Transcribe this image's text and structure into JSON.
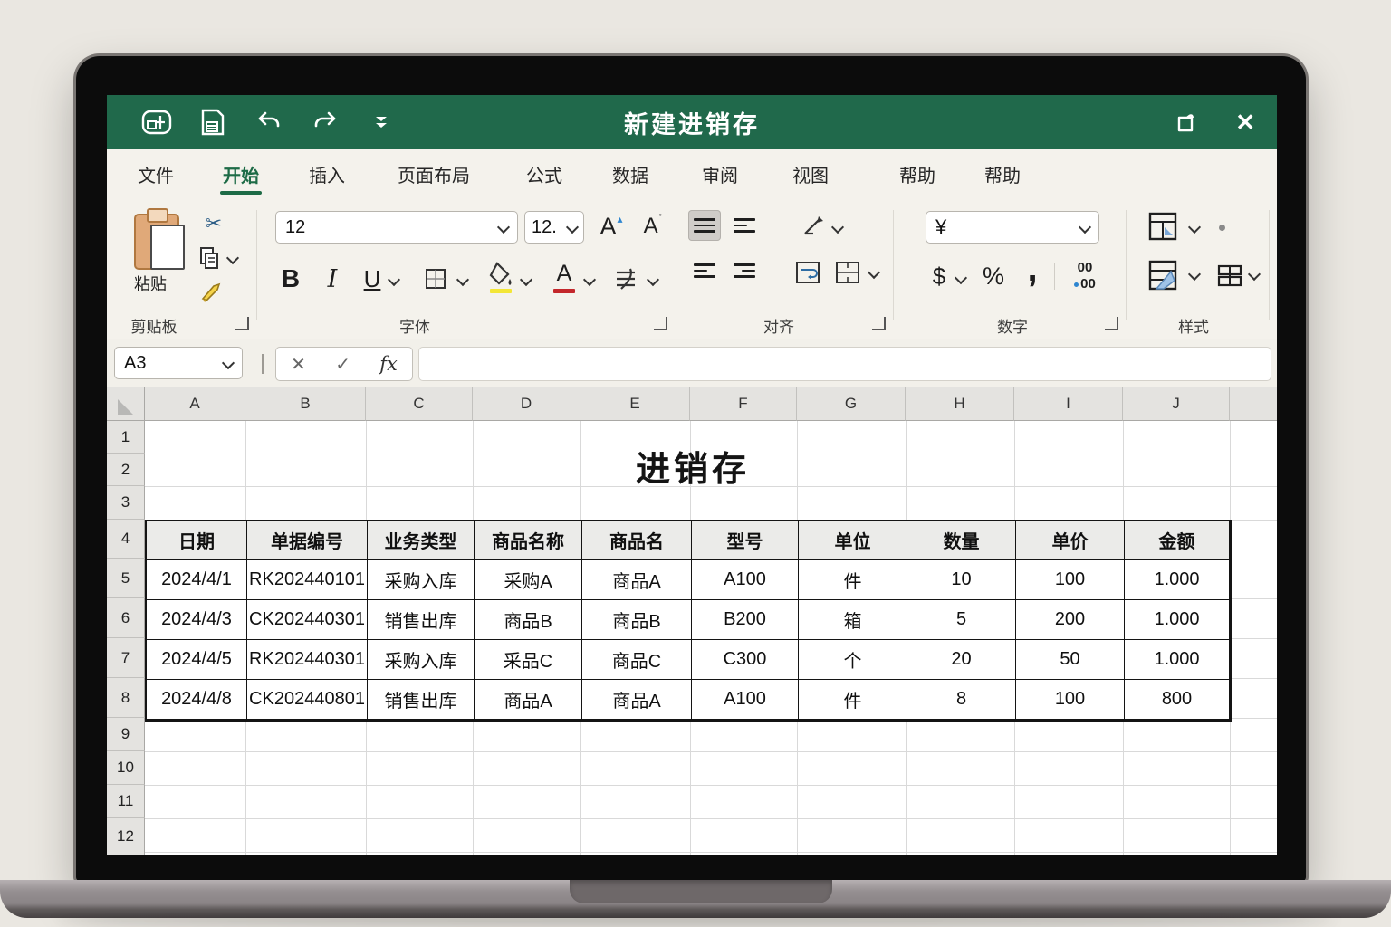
{
  "window": {
    "title": "新建进销存",
    "close_glyph": "✕"
  },
  "tabs": [
    "文件",
    "开始",
    "插入",
    "页面布局",
    "公式",
    "数据",
    "审阅",
    "视图",
    "帮助",
    "帮助"
  ],
  "ribbon": {
    "clipboard": {
      "paste_label": "粘贴",
      "group_label": "剪贴板"
    },
    "font": {
      "name_value": "12",
      "size_value": "12.",
      "grow": "A",
      "shrink": "A",
      "bold": "B",
      "italic": "I",
      "underline": "U",
      "font_color_letter": "A",
      "group_label": "字体"
    },
    "alignment": {
      "group_label": "对齐"
    },
    "number": {
      "currency_value": "¥",
      "dollar": "$",
      "percent": "%",
      "comma": ",",
      "zeros_top": "00",
      "zeros_bottom": "00",
      "group_label": "数字"
    },
    "styles": {
      "group_label": "样式"
    }
  },
  "formula_bar": {
    "name_box": "A3",
    "cancel": "✕",
    "enter": "✓",
    "fx": "fx"
  },
  "sheet": {
    "title": "进销存",
    "columns": [
      "A",
      "B",
      "C",
      "D",
      "E",
      "F",
      "G",
      "H",
      "I",
      "J"
    ],
    "rows": [
      "1",
      "2",
      "3",
      "4",
      "5",
      "6",
      "7",
      "8",
      "9",
      "10",
      "11",
      "12"
    ],
    "table": {
      "headers": [
        "日期",
        "单据编号",
        "业务类型",
        "商品名称",
        "商品名",
        "型号",
        "单位",
        "数量",
        "单价",
        "金额"
      ],
      "rows": [
        [
          "2024/4/1",
          "RK202440101",
          "采购入库",
          "采购A",
          "商品A",
          "A100",
          "件",
          "10",
          "100",
          "1.000"
        ],
        [
          "2024/4/3",
          "CK202440301",
          "销售出库",
          "商品B",
          "商品B",
          "B200",
          "箱",
          "5",
          "200",
          "1.000"
        ],
        [
          "2024/4/5",
          "RK202440301",
          "采购入库",
          "采品C",
          "商品C",
          "C300",
          "个",
          "20",
          "50",
          "1.000"
        ],
        [
          "2024/4/8",
          "CK202440801",
          "销售出库",
          "商品A",
          "商品A",
          "A100",
          "件",
          "8",
          "100",
          "800"
        ]
      ]
    }
  },
  "colors": {
    "titlebar_green": "#20694b",
    "active_tab_green": "#1d6b46",
    "fill_yellow": "#f3e636",
    "font_red": "#c3272b"
  }
}
